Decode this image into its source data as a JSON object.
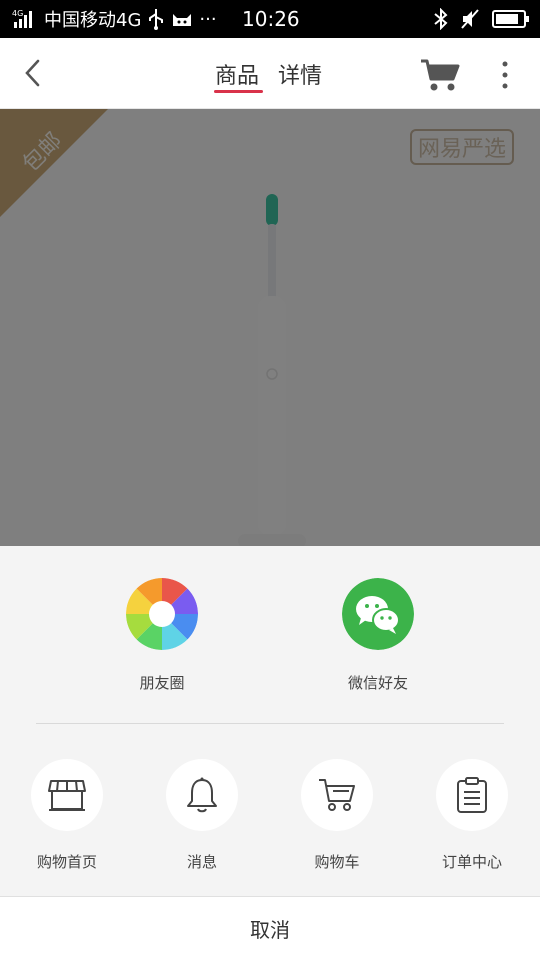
{
  "status_bar": {
    "signal_tag": "4G",
    "carrier": "中国移动4G",
    "extra": "···",
    "time": "10:26",
    "icons": [
      "usb-icon",
      "cat-icon",
      "bluetooth-icon",
      "mute-icon",
      "battery-icon"
    ]
  },
  "nav": {
    "back_icon": "chevron-left-icon",
    "tabs": [
      {
        "label": "商品",
        "active": true
      },
      {
        "label": "详情",
        "active": false
      }
    ],
    "cart_icon": "cart-icon",
    "more_icon": "more-vertical-icon",
    "accent_color": "#d9324a"
  },
  "product": {
    "free_shipping_badge": "包邮",
    "brand_watermark": "网易严选",
    "image": "electric-toothbrush"
  },
  "share_sheet": {
    "share_targets": [
      {
        "label": "朋友圈",
        "icon": "moments-icon"
      },
      {
        "label": "微信好友",
        "icon": "wechat-icon",
        "color": "#3cb34a"
      }
    ],
    "actions": [
      {
        "label": "购物首页",
        "icon": "store-icon"
      },
      {
        "label": "消息",
        "icon": "bell-icon"
      },
      {
        "label": "购物车",
        "icon": "cart-icon"
      },
      {
        "label": "订单中心",
        "icon": "clipboard-icon"
      }
    ],
    "cancel_label": "取消"
  }
}
